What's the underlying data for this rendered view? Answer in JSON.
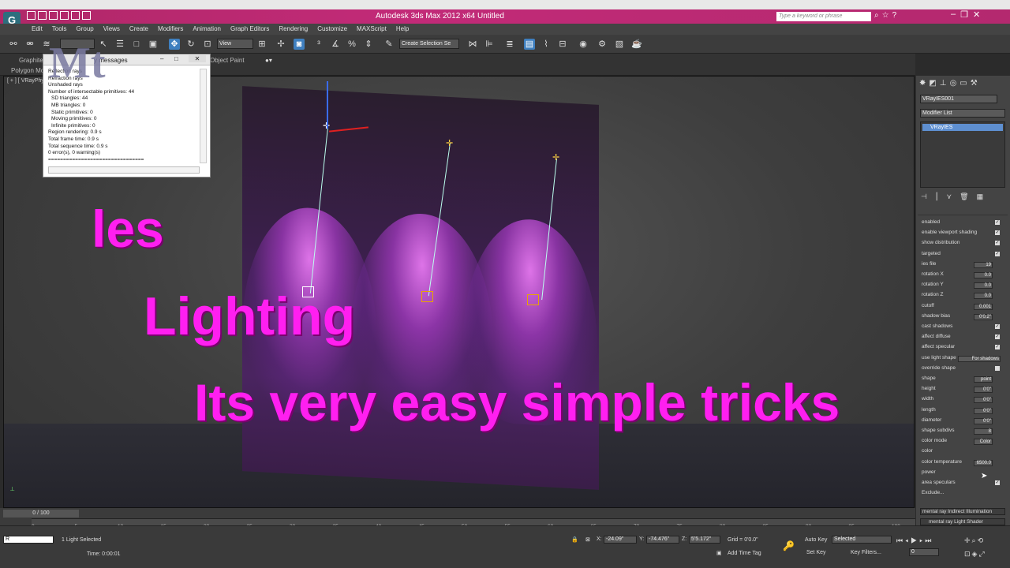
{
  "app": {
    "title": "Autodesk 3ds Max  2012 x64     Untitled",
    "logo": "G",
    "search_placeholder": "Type a keyword or phrase",
    "window_controls": [
      "–",
      "❐",
      "✕"
    ],
    "help_icons": [
      "⌕",
      "☆",
      "?"
    ]
  },
  "menu": [
    "Edit",
    "Tools",
    "Group",
    "Views",
    "Create",
    "Modifiers",
    "Animation",
    "Graph Editors",
    "Rendering",
    "Customize",
    "MAXScript",
    "Help"
  ],
  "toolbar": {
    "view_dropdown": "View",
    "selection_set": "Create Selection Se"
  },
  "ribbon": {
    "graphite": "Graphite",
    "polygon": "Polygon Mo",
    "object_paint": "Object Paint"
  },
  "viewport": {
    "label": "[ + ] [ VRayPhy"
  },
  "dialog": {
    "title": "y messages",
    "lines": [
      "Reflection rays",
      "Refraction rays",
      "Unshaded rays",
      "Number of intersectable primitives: 44",
      "SD triangles: 44",
      "MB triangles: 0",
      "Static primitives: 0",
      "Moving primitives: 0",
      "Infinite primitives: 0",
      "Region rendering: 0.9 s",
      "Total frame time: 0.9 s",
      "Total sequence time: 0.9 s",
      "0 error(s), 0 warning(s)",
      "================================"
    ]
  },
  "overlay": {
    "line1": "les",
    "line2": "Lighting",
    "line3": "Its very easy simple tricks",
    "logo": "Mt"
  },
  "command_panel": {
    "object_name": "VRayIES001",
    "modifier_list": "Modifier List",
    "stack_item": "VRayIES",
    "params": [
      {
        "label": "enabled",
        "check": "✓"
      },
      {
        "label": "enable viewport shading",
        "check": "✓"
      },
      {
        "label": "show distribution",
        "check": "✓"
      },
      {
        "label": "targeted",
        "check": "✓"
      },
      {
        "label": "ies file",
        "value": "19"
      },
      {
        "label": "rotation X",
        "value": "0.0"
      },
      {
        "label": "rotation Y",
        "value": "0.0"
      },
      {
        "label": "rotation Z",
        "value": "0.0"
      },
      {
        "label": "cutoff",
        "value": "0.001"
      },
      {
        "label": "shadow bias",
        "value": "0'0.2\""
      },
      {
        "label": "cast shadows",
        "check": "✓"
      },
      {
        "label": "affect diffuse",
        "check": "✓"
      },
      {
        "label": "affect specular",
        "check": "✓"
      },
      {
        "label": "use light shape",
        "value": "For shadows"
      },
      {
        "label": "override shape",
        "check": ""
      },
      {
        "label": "shape",
        "value": "point"
      },
      {
        "label": "height",
        "value": "0'0\""
      },
      {
        "label": "width",
        "value": "0'0\""
      },
      {
        "label": "length",
        "value": "0'0\""
      },
      {
        "label": "diameter",
        "value": "0'0\""
      },
      {
        "label": "shape subdivs",
        "value": "8"
      },
      {
        "label": "color mode",
        "value": "Color"
      },
      {
        "label": "color",
        "value": ""
      },
      {
        "label": "color temperature",
        "value": "6500.0"
      },
      {
        "label": "power",
        "value": ""
      },
      {
        "label": "area speculars",
        "check": "✓"
      },
      {
        "label": "Exclude...",
        "value": ""
      }
    ],
    "rollout1": "mental ray Indirect Illumination",
    "rollout2": "mental ray Light Shader"
  },
  "timeline": {
    "frame": "0 / 100",
    "ticks": [
      "0",
      "5",
      "10",
      "15",
      "20",
      "25",
      "30",
      "35",
      "40",
      "45",
      "50",
      "55",
      "60",
      "65",
      "70",
      "75",
      "80",
      "85",
      "90",
      "95",
      "100"
    ]
  },
  "status": {
    "selected": "1 Light Selected",
    "time": "Time: 0:00:01",
    "x": "-24.09\"",
    "y": "-74.476\"",
    "z": "5'5.172\"",
    "grid": "Grid = 0'0.0\"",
    "auto_key": "Auto Key",
    "set_key": "Set Key",
    "key_mode": "Selected",
    "key_filters": "Key Filters...",
    "add_time_tag": "Add Time Tag",
    "frame_value": "0",
    "script": "R"
  }
}
